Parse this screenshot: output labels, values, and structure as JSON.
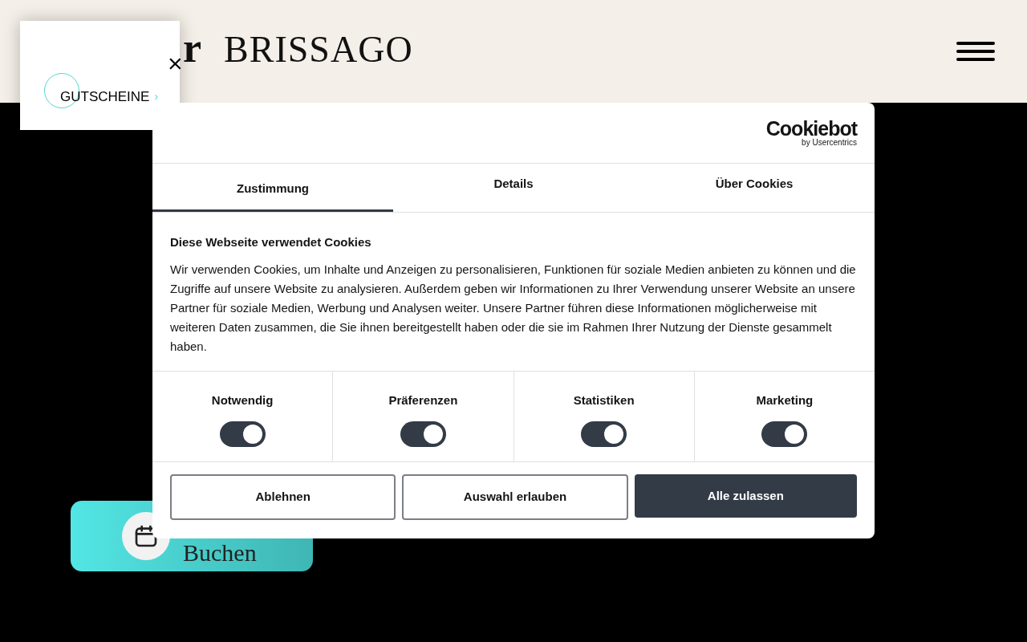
{
  "header": {
    "logo_partial": "r",
    "logo_name": "BRISSAGO"
  },
  "voucher_popup": {
    "close": "×",
    "link": "GUTSCHEINE",
    "arrow": "›"
  },
  "book_button": {
    "label": "Buchen"
  },
  "cookie_dialog": {
    "brand": "Cookiebot",
    "brand_sub": "by Usercentrics",
    "tabs": [
      {
        "label": "Zustimmung",
        "selected": true
      },
      {
        "label": "Details",
        "selected": false
      },
      {
        "label": "Über Cookies",
        "selected": false
      }
    ],
    "heading": "Diese Webseite verwendet Cookies",
    "text": "Wir verwenden Cookies, um Inhalte und Anzeigen zu personalisieren, Funktionen für soziale Medien anbieten zu können und die Zugriffe auf unsere Website zu analysieren. Außerdem geben wir Informationen zu Ihrer Verwendung unserer Website an unsere Partner für soziale Medien, Werbung und Analysen weiter. Unsere Partner führen diese Informationen möglicherweise mit weiteren Daten zusammen, die Sie ihnen bereitgestellt haben oder die sie im Rahmen Ihrer Nutzung der Dienste gesammelt haben.",
    "categories": [
      {
        "label": "Notwendig",
        "on": true
      },
      {
        "label": "Präferenzen",
        "on": true
      },
      {
        "label": "Statistiken",
        "on": true
      },
      {
        "label": "Marketing",
        "on": true
      }
    ],
    "buttons": [
      {
        "label": "Ablehnen",
        "kind": "outline"
      },
      {
        "label": "Auswahl erlauben",
        "kind": "outline"
      },
      {
        "label": "Alle zulassen",
        "kind": "primary"
      }
    ]
  }
}
